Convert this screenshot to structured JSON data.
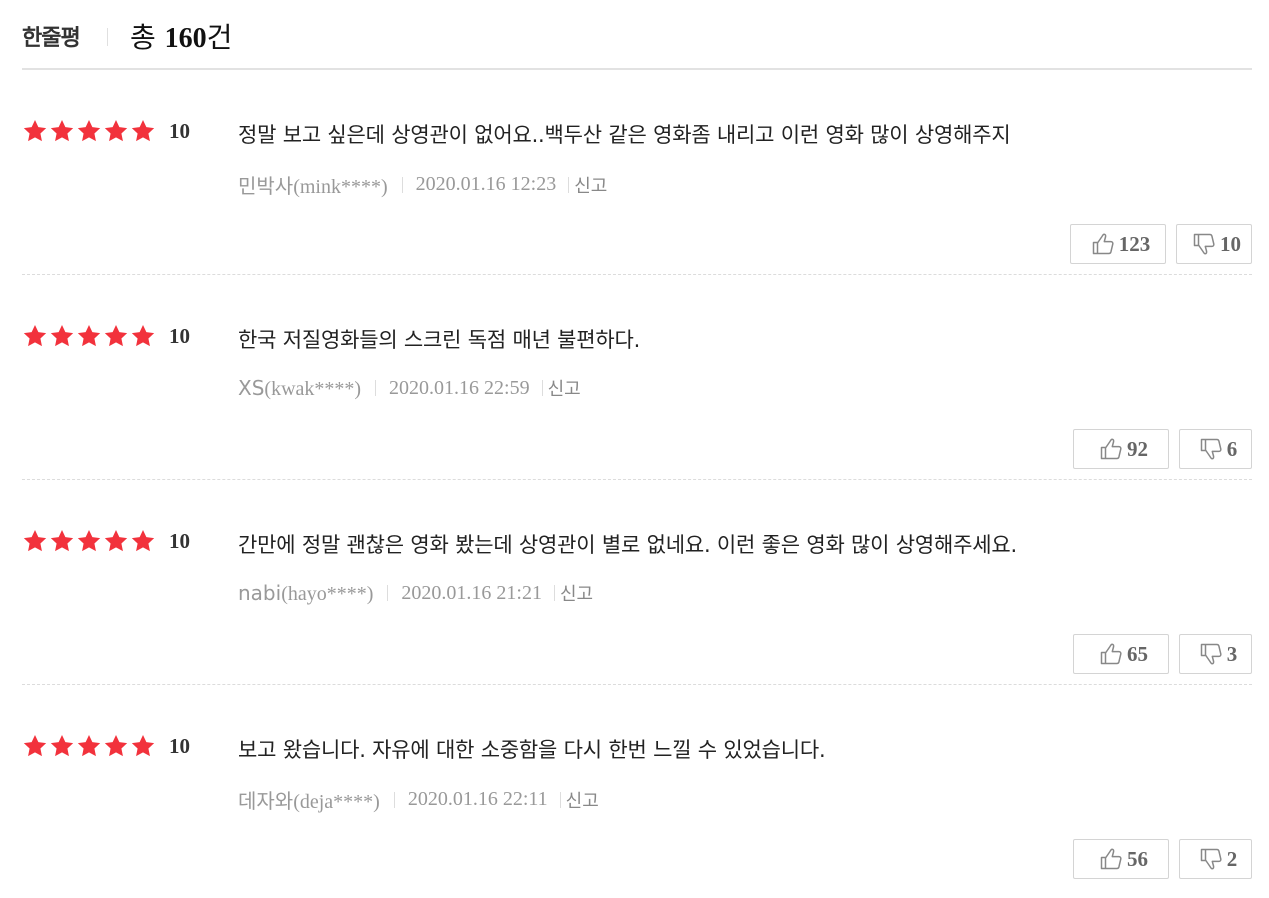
{
  "header": {
    "title": "한줄평",
    "total_prefix": "총 ",
    "total_count": "160",
    "total_suffix": "건"
  },
  "colors": {
    "star": "#f2323c",
    "text": "#222222",
    "meta": "#999999",
    "border": "#d4d4d4"
  },
  "reviews": [
    {
      "stars": 5,
      "score": "10",
      "comment": "정말 보고 싶은데 상영관이 없어요..백두산 같은 영화좀 내리고 이런 영화 많이 상영해주지",
      "nickname": "민박사",
      "user_id": "(mink****)",
      "date": "2020.01.16 12:23",
      "report_label": "신고",
      "likes": "123",
      "dislikes": "10"
    },
    {
      "stars": 5,
      "score": "10",
      "comment": "한국 저질영화들의 스크린 독점 매년 불편하다.",
      "nickname": "XS",
      "user_id": "(kwak****)",
      "date": "2020.01.16 22:59",
      "report_label": "신고",
      "likes": "92",
      "dislikes": "6"
    },
    {
      "stars": 5,
      "score": "10",
      "comment": "간만에 정말 괜찮은 영화 봤는데 상영관이 별로 없네요. 이런 좋은 영화 많이 상영해주세요.",
      "nickname": "nabi",
      "user_id": "(hayo****)",
      "date": "2020.01.16 21:21",
      "report_label": "신고",
      "likes": "65",
      "dislikes": "3"
    },
    {
      "stars": 5,
      "score": "10",
      "comment": "보고 왔습니다. 자유에 대한 소중함을 다시 한번 느낄 수 있었습니다.",
      "nickname": "데자와",
      "user_id": "(deja****)",
      "date": "2020.01.16 22:11",
      "report_label": "신고",
      "likes": "56",
      "dislikes": "2"
    }
  ]
}
